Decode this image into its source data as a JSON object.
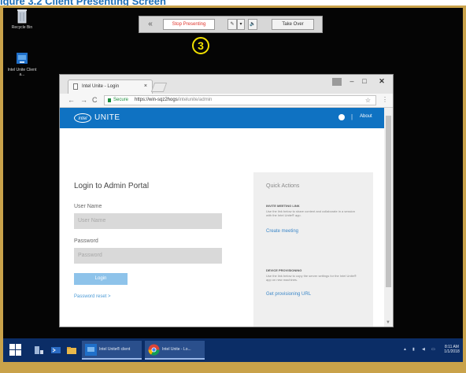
{
  "figure_caption": "igure 3.2 Client Presenting Screen",
  "toolbar": {
    "collapse_glyph": "«",
    "stop_label": "Stop Presenting",
    "pen_glyph": "✎",
    "caret_glyph": "▾",
    "speaker_glyph": "🔈",
    "take_over_label": "Take Over"
  },
  "step_badge": "3",
  "desktop_icons": [
    {
      "label": "Recycle Bin",
      "icon": "recycle-bin-icon"
    },
    {
      "label": "Intel Unite Client a...",
      "icon": "intel-unite-client-icon"
    }
  ],
  "browser": {
    "tab_label": "Intel Unite - Login",
    "tab_close": "×",
    "window_controls": {
      "minimize": "–",
      "maximize": "□",
      "close": "✕"
    },
    "nav": {
      "back": "←",
      "forward": "→",
      "reload": "C"
    },
    "secure_label": "Secure",
    "url_host": "https://win-sqz2hogs",
    "url_path": "/intelunite/admin",
    "star": "☆",
    "menu": "⋮"
  },
  "app": {
    "brand_intel": "intel",
    "brand_name": "UNITE",
    "sep": "|",
    "about_label": "About"
  },
  "login": {
    "title": "Login to Admin Portal",
    "username_label": "User Name",
    "username_placeholder": "User Name",
    "password_label": "Password",
    "password_placeholder": "Password",
    "login_button": "Login",
    "reset_link": "Password reset >"
  },
  "quick_actions": {
    "title": "Quick Actions",
    "invite_heading": "INVITE MEETING LINK",
    "invite_desc": "Use the link below to share content and collaborate in a session with the Intel Unite® app.",
    "invite_link": "Create meeting",
    "provision_heading": "DEVICE PROVISIONING",
    "provision_desc": "Use the link below to copy the server settings for the Intel Unite® app on new machines.",
    "provision_link": "Get provisioning URL"
  },
  "taskbar": {
    "apps": [
      {
        "label": "Intel Unite® client",
        "icon": "intel-unite-taskbar-icon"
      },
      {
        "label": "Intel Unite - Lo...",
        "icon": "chrome-taskbar-icon"
      }
    ],
    "clock_time": "8:11 AM",
    "clock_date": "1/1/2018"
  },
  "colors": {
    "frame": "#c9a24a",
    "accent": "#0f72c2",
    "stop": "#e0332b",
    "step": "#f0e000",
    "taskbar": "#0b2d66"
  }
}
